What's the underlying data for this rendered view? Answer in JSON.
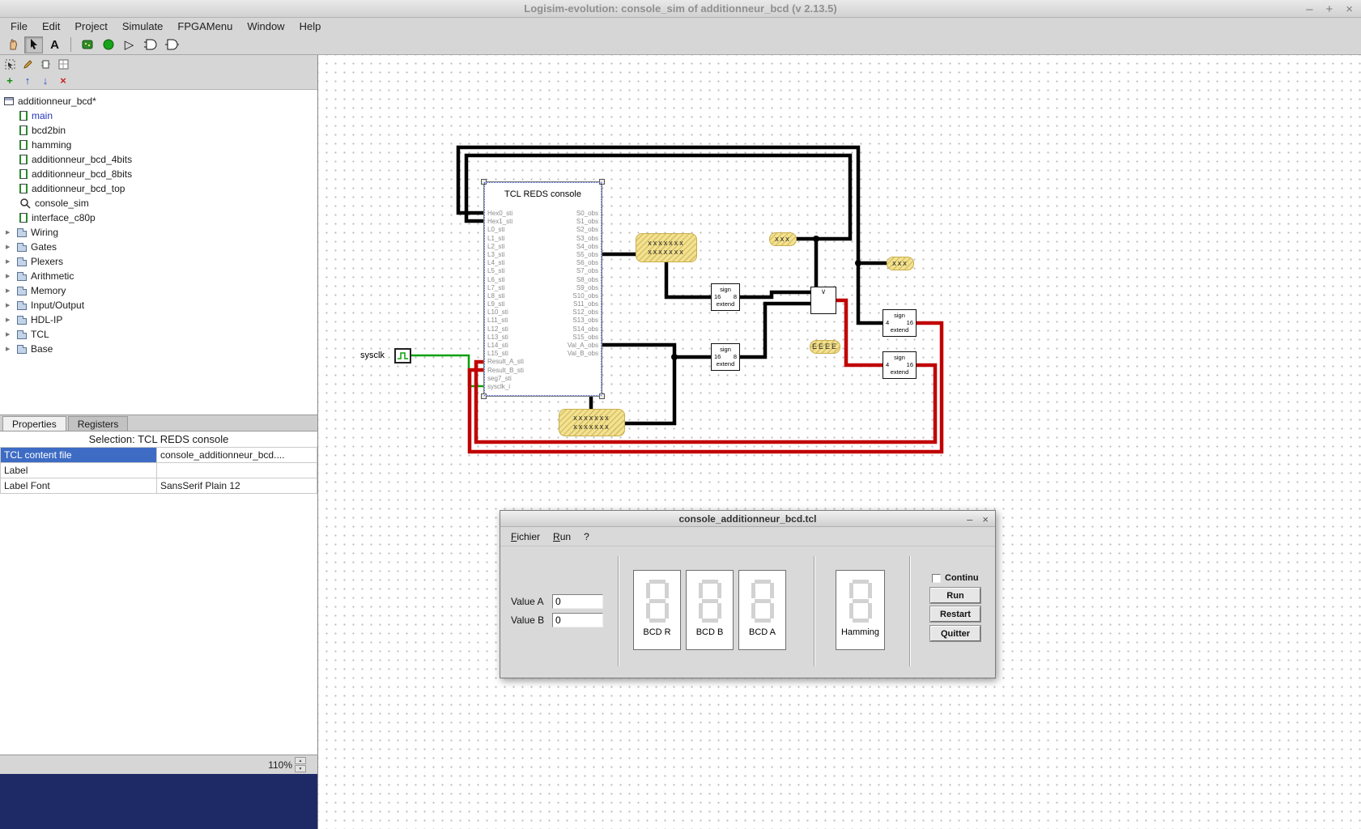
{
  "window": {
    "title": "Logisim-evolution: console_sim of additionneur_bcd (v 2.13.5)",
    "minimize": "–",
    "maximize": "+",
    "close": "×"
  },
  "menubar": [
    "File",
    "Edit",
    "Project",
    "Simulate",
    "FPGAMenu",
    "Window",
    "Help"
  ],
  "toolbar": {
    "text_tool": "A"
  },
  "icons": {
    "expander": "▶",
    "spinner_up": "▲",
    "spinner_down": "▼",
    "add": "+",
    "move_up": "↑",
    "move_down": "↓",
    "remove": "×",
    "tick": "▷",
    "comparator_mark": "∨"
  },
  "explorer": {
    "root": "additionneur_bcd*",
    "circuits": [
      "main",
      "bcd2bin",
      "hamming",
      "additionneur_bcd_4bits",
      "additionneur_bcd_8bits",
      "additionneur_bcd_top",
      "console_sim",
      "interface_c80p"
    ],
    "libraries": [
      "Wiring",
      "Gates",
      "Plexers",
      "Arithmetic",
      "Memory",
      "Input/Output",
      "HDL-IP",
      "TCL",
      "Base"
    ]
  },
  "properties_panel": {
    "tab_properties": "Properties",
    "tab_registers": "Registers",
    "selection_title": "Selection: TCL REDS console",
    "rows": [
      {
        "label": "TCL content file",
        "value": "console_additionneur_bcd...."
      },
      {
        "label": "Label",
        "value": ""
      },
      {
        "label": "Label Font",
        "value": "SansSerif Plain 12"
      }
    ]
  },
  "statusbar": {
    "zoom": "110%"
  },
  "canvas": {
    "console": {
      "title": "TCL REDS console",
      "left_pins": [
        "Hex0_sti",
        "Hex1_sti",
        "L0_sti",
        "L1_sti",
        "L2_sti",
        "L3_sti",
        "L4_sti",
        "L5_sti",
        "L6_sti",
        "L7_sti",
        "L8_sti",
        "L9_sti",
        "L10_sti",
        "L11_sti",
        "L12_sti",
        "L13_sti",
        "L14_sti",
        "L15_sti",
        "Result_A_sti",
        "Result_B_sti",
        "seg7_sti",
        "sysclk_i"
      ],
      "right_pins": [
        "S0_obs",
        "S1_obs",
        "S2_obs",
        "S3_obs",
        "S4_obs",
        "S5_obs",
        "S6_obs",
        "S7_obs",
        "S8_obs",
        "S9_obs",
        "S10_obs",
        "S11_obs",
        "S12_obs",
        "S13_obs",
        "S14_obs",
        "S15_obs",
        "Val_A_obs",
        "Val_B_obs"
      ]
    },
    "sysclk_label": "sysclk",
    "se16_8": {
      "top": "sign",
      "in": "16",
      "out": "8",
      "bottom": "extend"
    },
    "se4_16": {
      "top": "sign",
      "in": "4",
      "out": "16",
      "bottom": "extend"
    },
    "probe7": "xxxxxxx",
    "probe3": "xxx",
    "probeE": "EEEE"
  },
  "dialog": {
    "title": "console_additionneur_bcd.tcl",
    "minimize": "–",
    "close": "×",
    "menu": [
      "Fichier",
      "Run",
      "?"
    ],
    "value_a_label": "Value A",
    "value_b_label": "Value B",
    "value_a": "0",
    "value_b": "0",
    "displays": [
      "BCD R",
      "BCD B",
      "BCD A",
      "Hamming"
    ],
    "continu_label": "Continu",
    "buttons": [
      "Run",
      "Restart",
      "Quitter"
    ]
  }
}
